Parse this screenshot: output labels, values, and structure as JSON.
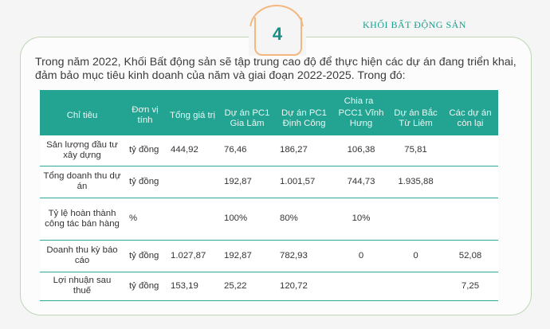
{
  "header": {
    "badge_number": "4",
    "section_label": "KHỐI BẤT ĐỘNG SẢN"
  },
  "intro": "Trong năm 2022, Khối Bất động sản sẽ tập trung cao độ để thực hiện các dự án đang triển khai, đảm bảo mục tiêu kinh doanh của năm và giai đoạn 2022-2025. Trong đó:",
  "table": {
    "headers": {
      "indicator": "Chỉ tiêu",
      "unit": "Đơn vị tính",
      "total": "Tổng giá trị",
      "breakdown": "Chia ra",
      "projects": [
        "Dự án PC1 Gia Lâm",
        "Dự án PC1 Định Công",
        "PCC1 Vĩnh Hưng",
        "Dự án Bắc Từ Liêm",
        "Các dự án còn lại"
      ]
    },
    "rows": [
      {
        "label": "Sản lượng đầu tư xây dựng",
        "unit": "tỷ đồng",
        "total": "444,92",
        "p1": "76,46",
        "p2": "186,27",
        "p3": "106,38",
        "p4": "75,81",
        "p5": ""
      },
      {
        "label": "Tổng doanh thu dự án",
        "unit": "tỷ đồng",
        "total": "",
        "p1": "192,87",
        "p2": "1.001,57",
        "p3": "744,73",
        "p4": "1.935,88",
        "p5": ""
      },
      {
        "label": "Tỷ lệ hoàn thành công tác bán hàng",
        "unit": "%",
        "total": "",
        "p1": "100%",
        "p2": "80%",
        "p3": "10%",
        "p4": "",
        "p5": ""
      },
      {
        "label": "Doanh thu kỳ báo cáo",
        "unit": "tỷ đồng",
        "total": "1.027,87",
        "p1": "192,87",
        "p2": "782,93",
        "p3": "0",
        "p4": "0",
        "p5": "52,08"
      },
      {
        "label": "Lợi nhuận sau thuế",
        "unit": "tỷ đồng",
        "total": "153,19",
        "p1": "25,22",
        "p2": "120,72",
        "p3": "",
        "p4": "",
        "p5": "7,25"
      }
    ]
  }
}
